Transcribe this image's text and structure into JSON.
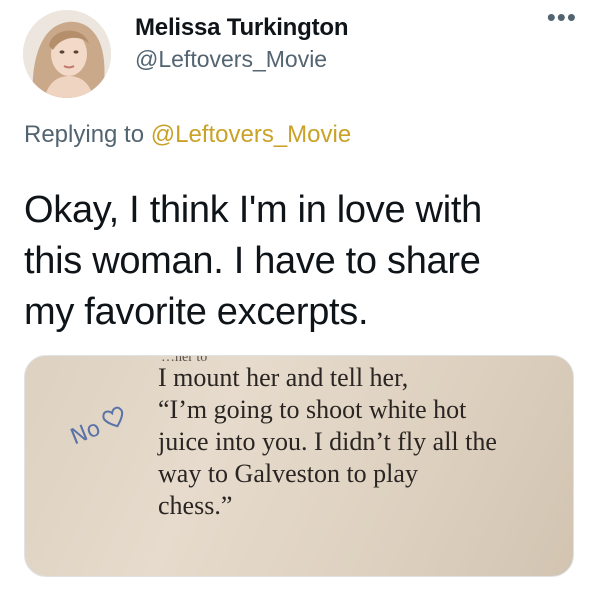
{
  "user": {
    "display_name": "Melissa Turkington",
    "handle": "@Leftovers_Movie",
    "avatar_icon": "avatar"
  },
  "menu": {
    "more_label": "•••"
  },
  "reply": {
    "prefix": "Replying to",
    "handle": "@Leftovers_Movie"
  },
  "tweet": {
    "text_lines": [
      "Okay, I think I'm in love with",
      "this woman. I have to share",
      "my favorite excerpts."
    ]
  },
  "media": {
    "top_scrap": "…ner to",
    "book_lines": [
      "I mount her and tell her,",
      "“I’m going to shoot white hot",
      "juice into you. I didn’t fly all the",
      "way to Galveston to play",
      "chess.”"
    ],
    "handwritten_note": "No",
    "handwritten_icon": "heart-icon"
  },
  "colors": {
    "link": "#c9a227",
    "secondary_text": "#536471",
    "primary_text": "#0f1419",
    "ink": "#5b73a8"
  }
}
